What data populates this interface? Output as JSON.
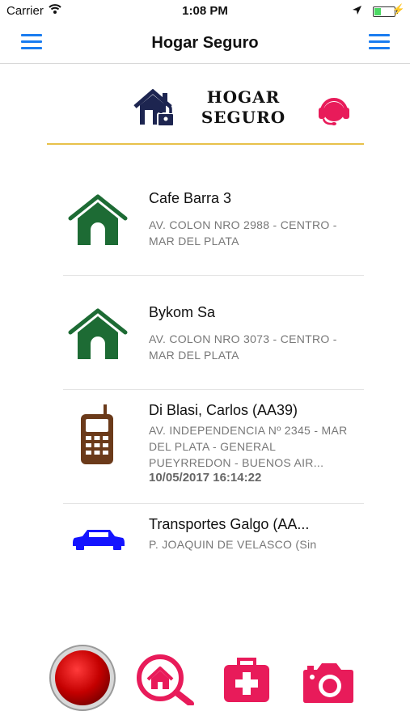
{
  "status_bar": {
    "carrier": "Carrier",
    "time": "1:08 PM"
  },
  "nav": {
    "title": "Hogar Seguro"
  },
  "brand": {
    "line1": "HOGAR",
    "line2": "SEGURO"
  },
  "items": [
    {
      "title": "Cafe Barra 3",
      "address": "AV. COLON NRO 2988 - CENTRO - MAR DEL PLATA",
      "icon": "house-icon"
    },
    {
      "title": "Bykom Sa",
      "address": "AV. COLON NRO 3073 - CENTRO - MAR DEL PLATA",
      "icon": "house-icon"
    },
    {
      "title": "Di Blasi, Carlos (AA39)",
      "address": "AV. INDEPENDENCIA Nº  2345 - MAR DEL PLATA -  GENERAL PUEYRREDON - BUENOS AIR...",
      "timestamp": "10/05/2017 16:14:22",
      "icon": "cellphone-icon"
    },
    {
      "title": "Transportes Galgo (AA...",
      "address": "P. JOAQUIN DE VELASCO (Sin",
      "icon": "car-icon"
    }
  ],
  "colors": {
    "accent": "#1a7cf0",
    "house": "#1d6b34",
    "phone": "#6b3a1a",
    "car": "#1414ff",
    "alert": "#e81b5a",
    "panic": "#c40000"
  }
}
